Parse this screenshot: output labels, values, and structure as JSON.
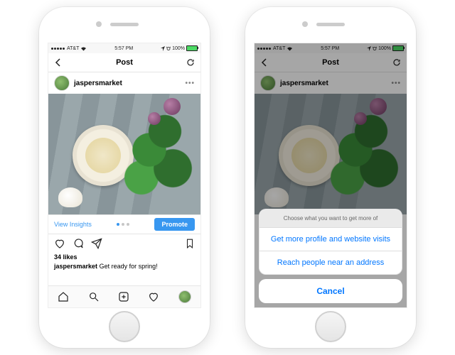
{
  "status": {
    "carrier": "AT&T",
    "wifi": true,
    "time": "5:57 PM",
    "battery_pct": "100%",
    "signal_bars": 5
  },
  "nav": {
    "title": "Post"
  },
  "post": {
    "username": "jaspersmarket",
    "likes_label": "34 likes",
    "caption_user": "jaspersmarket",
    "caption_text": "Get ready for spring!"
  },
  "insights": {
    "view_label": "View Insights",
    "promote_label": "Promote",
    "page_index": 0,
    "page_count": 3
  },
  "action_sheet": {
    "title": "Choose what you want to get more of",
    "options": [
      "Get more profile and website visits",
      "Reach people near an address"
    ],
    "cancel": "Cancel"
  }
}
